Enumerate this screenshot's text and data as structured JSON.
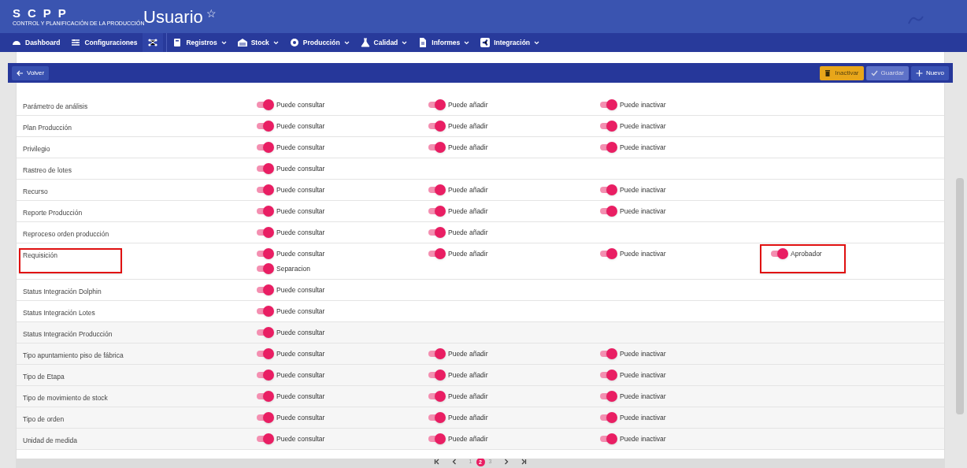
{
  "header": {
    "logo": "SCPP",
    "logo_subtitle": "CONTROL Y PLANIFICACIÓN DE LA PRODUCCIÓN",
    "title": "Usuario",
    "favorite_icon": "☆"
  },
  "nav": [
    {
      "kind": "dashboard",
      "label": "Dashboard",
      "dropdown": false
    },
    {
      "kind": "settings",
      "label": "Configuraciones",
      "dropdown": false
    },
    {
      "kind": "network",
      "dropdown": false
    },
    {
      "kind": "book",
      "label": "Registros",
      "dropdown": true
    },
    {
      "kind": "warehouse",
      "label": "Stock",
      "dropdown": true
    },
    {
      "kind": "gear",
      "label": "Producción",
      "dropdown": true
    },
    {
      "kind": "flask",
      "label": "Calidad",
      "dropdown": true
    },
    {
      "kind": "document",
      "label": "Informes",
      "dropdown": true
    },
    {
      "kind": "share",
      "label": "Integración",
      "dropdown": true
    }
  ],
  "toolbar": {
    "back": "Volver",
    "buttons": [
      {
        "kind": "warning",
        "label": "Inactivar",
        "disabled": false
      },
      {
        "kind": "save",
        "label": "Guardar",
        "disabled": true
      },
      {
        "kind": "add",
        "label": "Nuevo",
        "disabled": false
      }
    ]
  },
  "rows": [
    {
      "name": "Parámetro de análisis",
      "highlighted": false,
      "cells": [
        [
          {
            "label": "Puede consultar",
            "on": true,
            "highlighted": false
          }
        ],
        [
          {
            "label": "Puede añadir",
            "on": true,
            "highlighted": false
          }
        ],
        [
          {
            "label": "Puede inactivar",
            "on": true,
            "highlighted": false
          }
        ],
        []
      ]
    },
    {
      "name": "Plan Producción",
      "highlighted": false,
      "cells": [
        [
          {
            "label": "Puede consultar",
            "on": true,
            "highlighted": false
          }
        ],
        [
          {
            "label": "Puede añadir",
            "on": true,
            "highlighted": false
          }
        ],
        [
          {
            "label": "Puede inactivar",
            "on": true,
            "highlighted": false
          }
        ],
        []
      ]
    },
    {
      "name": "Privilegio",
      "highlighted": false,
      "cells": [
        [
          {
            "label": "Puede consultar",
            "on": true,
            "highlighted": false
          }
        ],
        [
          {
            "label": "Puede añadir",
            "on": true,
            "highlighted": false
          }
        ],
        [
          {
            "label": "Puede inactivar",
            "on": true,
            "highlighted": false
          }
        ],
        []
      ]
    },
    {
      "name": "Rastreo de lotes",
      "highlighted": false,
      "cells": [
        [
          {
            "label": "Puede consultar",
            "on": true,
            "highlighted": false
          }
        ],
        [],
        [],
        []
      ]
    },
    {
      "name": "Recurso",
      "highlighted": false,
      "cells": [
        [
          {
            "label": "Puede consultar",
            "on": true,
            "highlighted": false
          }
        ],
        [
          {
            "label": "Puede añadir",
            "on": true,
            "highlighted": false
          }
        ],
        [
          {
            "label": "Puede inactivar",
            "on": true,
            "highlighted": false
          }
        ],
        []
      ]
    },
    {
      "name": "Reporte Producción",
      "highlighted": false,
      "cells": [
        [
          {
            "label": "Puede consultar",
            "on": true,
            "highlighted": false
          }
        ],
        [
          {
            "label": "Puede añadir",
            "on": true,
            "highlighted": false
          }
        ],
        [
          {
            "label": "Puede inactivar",
            "on": true,
            "highlighted": false
          }
        ],
        []
      ]
    },
    {
      "name": "Reproceso orden producción",
      "highlighted": false,
      "cells": [
        [
          {
            "label": "Puede consultar",
            "on": true,
            "highlighted": false
          }
        ],
        [
          {
            "label": "Puede añadir",
            "on": true,
            "highlighted": false
          }
        ],
        [],
        []
      ]
    },
    {
      "name": "Requisición",
      "highlighted": true,
      "cells": [
        [
          {
            "label": "Puede consultar",
            "on": true,
            "highlighted": false
          },
          {
            "label": "Separacion",
            "on": true,
            "highlighted": false
          }
        ],
        [
          {
            "label": "Puede añadir",
            "on": true,
            "highlighted": false
          }
        ],
        [
          {
            "label": "Puede inactivar",
            "on": true,
            "highlighted": false
          }
        ],
        [
          {
            "label": "Aprobador",
            "on": true,
            "highlighted": true
          }
        ]
      ]
    },
    {
      "name": "Status Integración Dolphin",
      "highlighted": false,
      "cells": [
        [
          {
            "label": "Puede consultar",
            "on": true,
            "highlighted": false
          }
        ],
        [],
        [],
        []
      ]
    },
    {
      "name": "Status Integración Lotes",
      "highlighted": false,
      "cells": [
        [
          {
            "label": "Puede consultar",
            "on": true,
            "highlighted": false
          }
        ],
        [],
        [],
        []
      ]
    },
    {
      "name": "Status Integración Producción",
      "highlighted": false,
      "cells": [
        [
          {
            "label": "Puede consultar",
            "on": true,
            "highlighted": false
          }
        ],
        [],
        [],
        []
      ]
    },
    {
      "name": "Tipo apuntamiento piso de fábrica",
      "highlighted": false,
      "cells": [
        [
          {
            "label": "Puede consultar",
            "on": true,
            "highlighted": false
          }
        ],
        [
          {
            "label": "Puede añadir",
            "on": true,
            "highlighted": false
          }
        ],
        [
          {
            "label": "Puede inactivar",
            "on": true,
            "highlighted": false
          }
        ],
        []
      ]
    },
    {
      "name": "Tipo de Etapa",
      "highlighted": false,
      "cells": [
        [
          {
            "label": "Puede consultar",
            "on": true,
            "highlighted": false
          }
        ],
        [
          {
            "label": "Puede añadir",
            "on": true,
            "highlighted": false
          }
        ],
        [
          {
            "label": "Puede inactivar",
            "on": true,
            "highlighted": false
          }
        ],
        []
      ]
    },
    {
      "name": "Tipo de movimiento de stock",
      "highlighted": false,
      "cells": [
        [
          {
            "label": "Puede consultar",
            "on": true,
            "highlighted": false
          }
        ],
        [
          {
            "label": "Puede añadir",
            "on": true,
            "highlighted": false
          }
        ],
        [
          {
            "label": "Puede inactivar",
            "on": true,
            "highlighted": false
          }
        ],
        []
      ]
    },
    {
      "name": "Tipo de orden",
      "highlighted": false,
      "cells": [
        [
          {
            "label": "Puede consultar",
            "on": true,
            "highlighted": false
          }
        ],
        [
          {
            "label": "Puede añadir",
            "on": true,
            "highlighted": false
          }
        ],
        [
          {
            "label": "Puede inactivar",
            "on": true,
            "highlighted": false
          }
        ],
        []
      ]
    },
    {
      "name": "Unidad de medida",
      "highlighted": false,
      "cells": [
        [
          {
            "label": "Puede consultar",
            "on": true,
            "highlighted": false
          }
        ],
        [
          {
            "label": "Puede añadir",
            "on": true,
            "highlighted": false
          }
        ],
        [
          {
            "label": "Puede inactivar",
            "on": true,
            "highlighted": false
          }
        ],
        []
      ]
    }
  ],
  "pagination": {
    "pages": [
      {
        "label": "1",
        "selected": false
      },
      {
        "label": "2",
        "selected": true
      },
      {
        "label": "3",
        "selected": false
      }
    ]
  }
}
